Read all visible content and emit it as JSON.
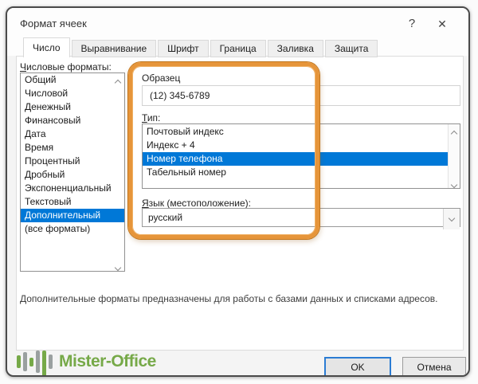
{
  "window": {
    "title": "Формат ячеек",
    "help_icon": "?",
    "close_icon": "✕"
  },
  "tabs": [
    {
      "label": "Число",
      "active": true
    },
    {
      "label": "Выравнивание",
      "active": false
    },
    {
      "label": "Шрифт",
      "active": false
    },
    {
      "label": "Граница",
      "active": false
    },
    {
      "label": "Заливка",
      "active": false
    },
    {
      "label": "Защита",
      "active": false
    }
  ],
  "number_formats": {
    "label_accel": "Ч",
    "label_rest": "исловые форматы:",
    "items": [
      "Общий",
      "Числовой",
      "Денежный",
      "Финансовый",
      "Дата",
      "Время",
      "Процентный",
      "Дробный",
      "Экспоненциальный",
      "Текстовый",
      "Дополнительный",
      "(все форматы)"
    ],
    "selected": "Дополнительный"
  },
  "sample": {
    "label": "Образец",
    "value": "(12) 345-6789"
  },
  "type": {
    "label_accel": "Т",
    "label_rest": "ип:",
    "items": [
      "Почтовый индекс",
      "Индекс + 4",
      "Номер телефона",
      "Табельный номер"
    ],
    "selected": "Номер телефона"
  },
  "language": {
    "label_accel": "Я",
    "label_rest": "зык (местоположение):",
    "value": "русский"
  },
  "description": "Дополнительные форматы предназначены для работы с базами данных и списками адресов.",
  "footer": {
    "logo_text": "Mister-Office",
    "ok_label": "OK",
    "cancel_label": "Отмена"
  },
  "colors": {
    "selection": "#0078d7",
    "annotation": "#e6953a",
    "annotation_dark": "#c1761d",
    "logo_green": "#76a948",
    "logo_gray": "#9aa0a0",
    "default_button_border": "#2b7cd3"
  }
}
